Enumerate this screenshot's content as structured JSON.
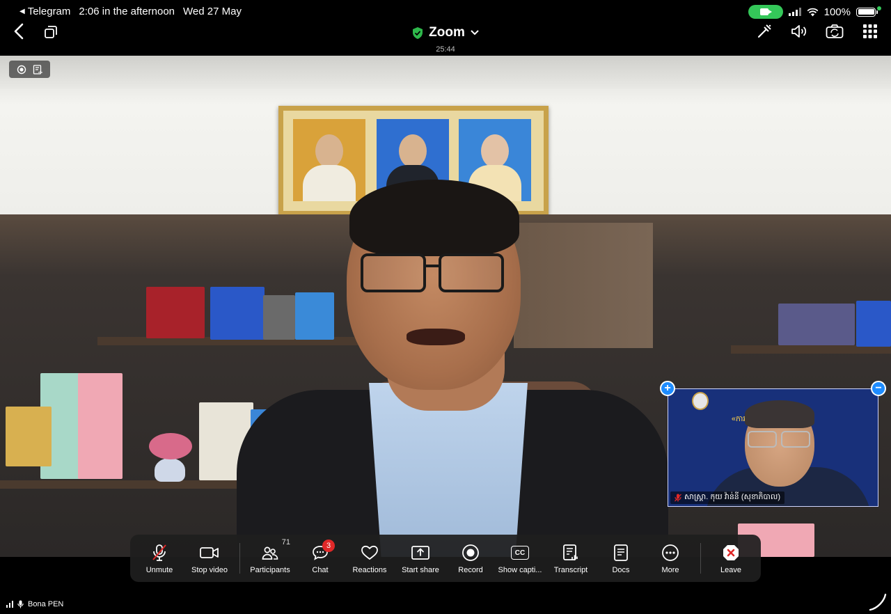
{
  "status_bar": {
    "back_app": "Telegram",
    "time": "2:06 in the afternoon",
    "date": "Wed 27 May",
    "battery": "100%",
    "battery_level": 1.0,
    "camera_indicator_color": "#34c759"
  },
  "meeting": {
    "title": "Zoom",
    "elapsed": "25:44",
    "secure_icon_color": "#2eb84b"
  },
  "top_actions": [
    "whiteboard-icon",
    "speaker-icon",
    "switch-camera-icon",
    "apps-grid-icon"
  ],
  "pip": {
    "banner": "«ការពង្រឹងប្រសិទ្ធភា... ជាតិ»",
    "name": "សាស្ត្រា. កុយ វ៉ាន់នី (សុខាភិបាល)",
    "muted": true
  },
  "toolbar": {
    "unmute": "Unmute",
    "stop_video": "Stop video",
    "participants": "Participants",
    "participants_count": "71",
    "chat": "Chat",
    "chat_badge": "3",
    "reactions": "Reactions",
    "start_share": "Start share",
    "record": "Record",
    "show_captions": "Show capti...",
    "captions_icon_text": "CC",
    "transcript": "Transcript",
    "docs": "Docs",
    "more": "More",
    "leave": "Leave",
    "leave_color": "#e02828"
  },
  "active_speaker": {
    "name": "Bona PEN"
  }
}
